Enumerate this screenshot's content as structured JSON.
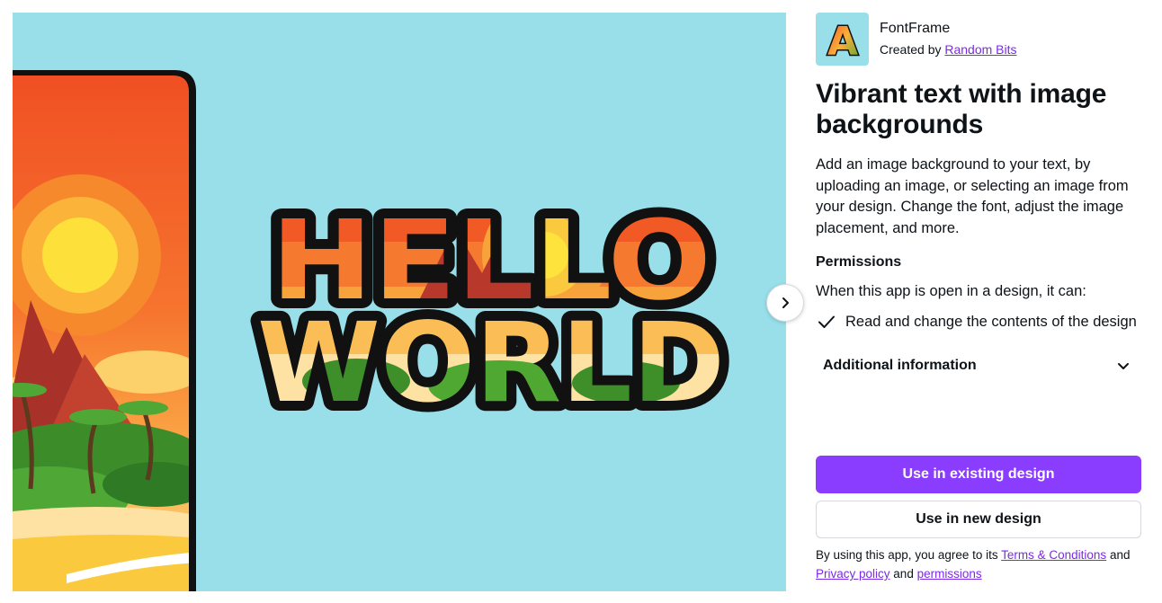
{
  "preview": {
    "artwork_text": [
      "HELLO",
      "WORLD"
    ],
    "next_button_icon": "chevron-right-icon"
  },
  "app": {
    "icon": "fontframe-logo-icon",
    "logo_letter": "A",
    "name": "FontFrame",
    "created_by_prefix": "Created by",
    "creator": "Random Bits",
    "title": "Vibrant text with image backgrounds",
    "description": "Add an image background to your text, by uploading an image, or selecting an image from your design. Change the font, adjust the image placement, and more."
  },
  "permissions": {
    "heading": "Permissions",
    "intro": "When this app is open in a design, it can:",
    "items": [
      {
        "icon": "checkmark-icon",
        "text": "Read and change the contents of the design"
      }
    ]
  },
  "additional_info": {
    "label": "Additional information",
    "icon": "chevron-down-icon"
  },
  "actions": {
    "use_existing": "Use in existing design",
    "use_new": "Use in new design"
  },
  "legal": {
    "prefix": "By using this app, you agree to its",
    "terms": "Terms & Conditions",
    "and1": "and",
    "privacy": "Privacy policy",
    "and2": "and",
    "permissions_link": "permissions"
  },
  "colors": {
    "accent": "#8b3dff",
    "link": "#7d2ae8",
    "preview_background": "#98dfea",
    "text": "#0e1318"
  }
}
